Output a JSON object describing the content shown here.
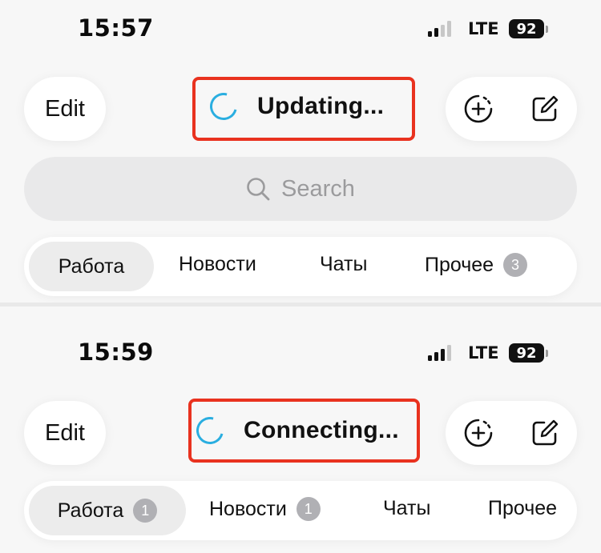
{
  "screens": [
    {
      "time": "15:57",
      "network": "LTE",
      "battery": "92",
      "edit_label": "Edit",
      "status_text": "Updating...",
      "search_placeholder": "Search",
      "tabs": [
        {
          "label": "Работа",
          "active": true
        },
        {
          "label": "Новости"
        },
        {
          "label": "Чаты"
        },
        {
          "label": "Прочее",
          "badge": "3"
        }
      ]
    },
    {
      "time": "15:59",
      "network": "LTE",
      "battery": "92",
      "edit_label": "Edit",
      "status_text": "Connecting...",
      "tabs": [
        {
          "label": "Работа",
          "active": true,
          "badge": "1"
        },
        {
          "label": "Новости",
          "badge": "1"
        },
        {
          "label": "Чаты"
        },
        {
          "label": "Прочее"
        }
      ]
    }
  ],
  "colors": {
    "spinner": "#2aaee0",
    "highlight": "#e9321f",
    "badge": "#b0b0b4"
  },
  "icons": [
    "search-icon",
    "new-story-icon",
    "compose-icon",
    "spinner-icon",
    "signal-icon",
    "battery-icon"
  ]
}
